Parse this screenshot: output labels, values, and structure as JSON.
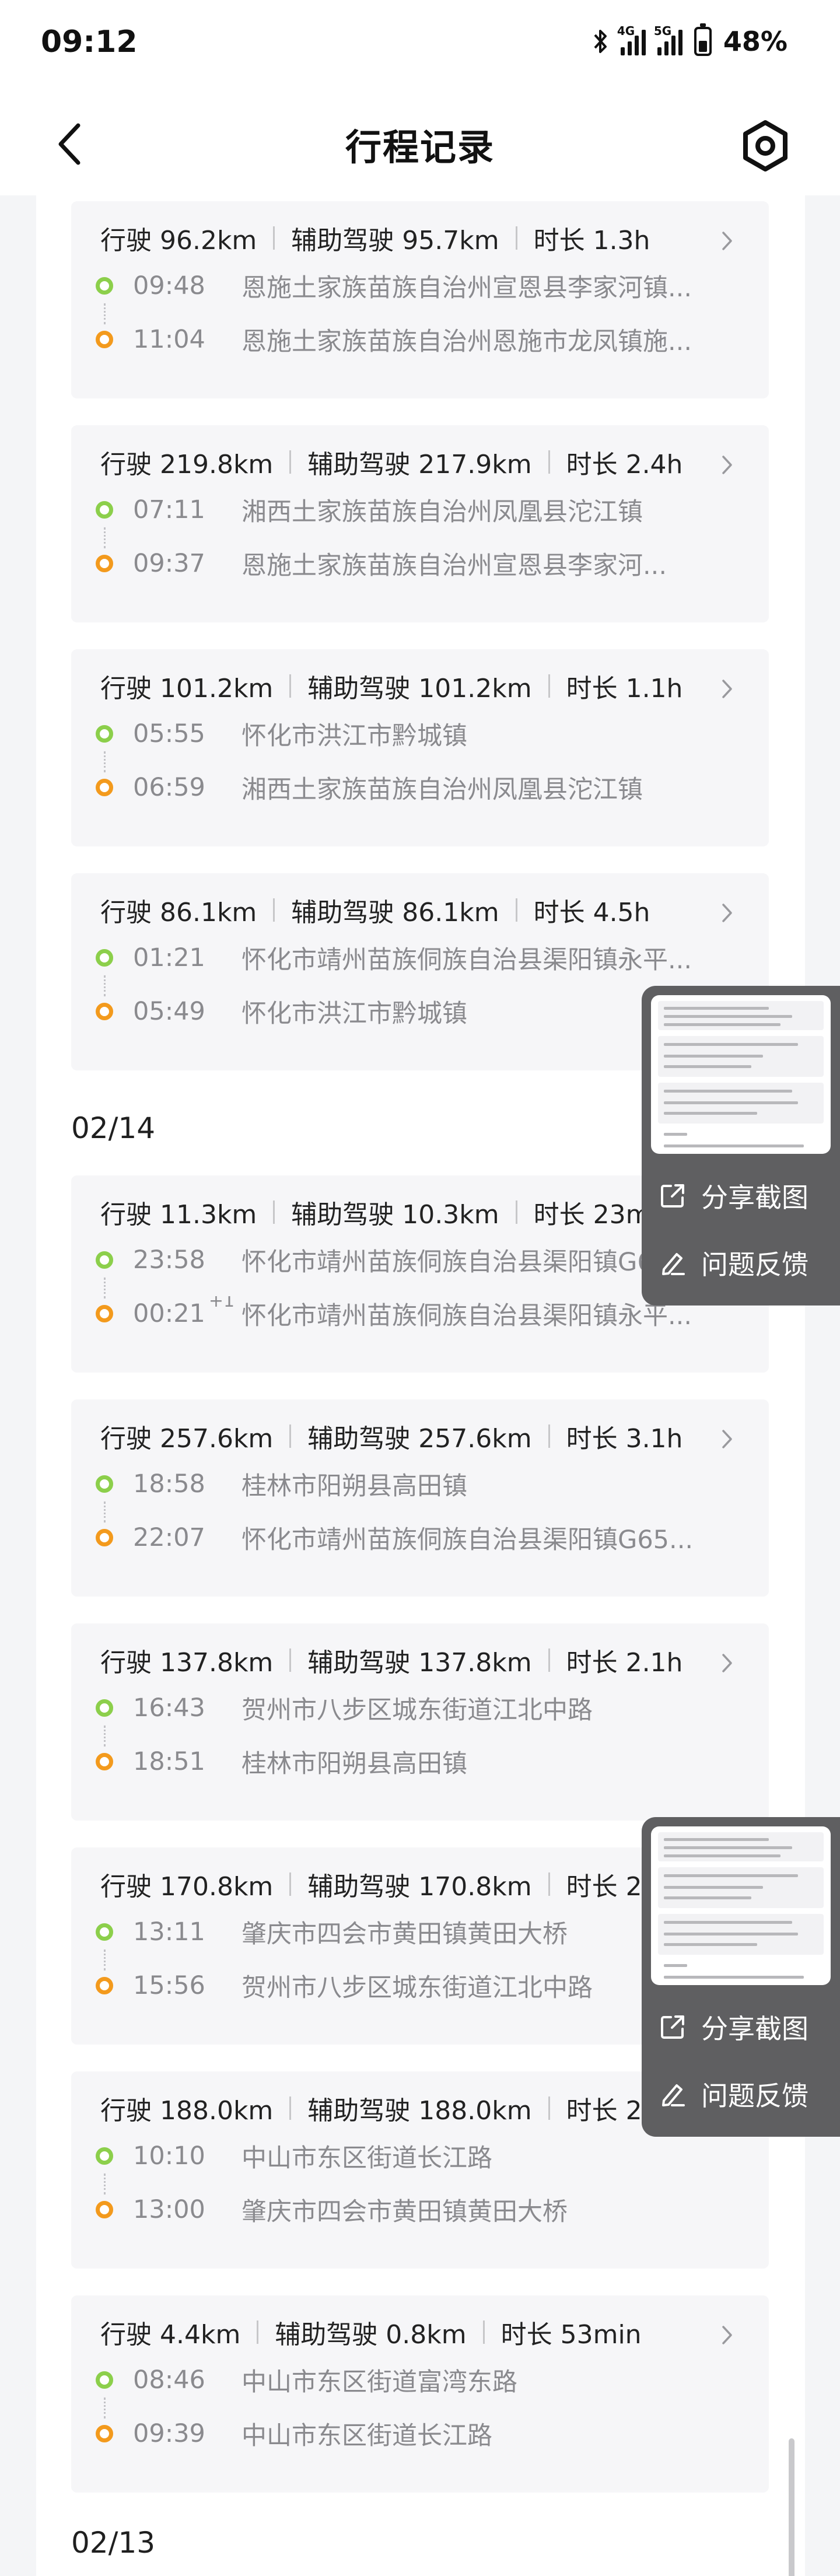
{
  "status_bar": {
    "time": "09:12",
    "network_1": "4G",
    "network_2": "5G",
    "battery": "48%"
  },
  "header": {
    "title": "行程记录"
  },
  "trips": [
    {
      "distance": "行驶 96.2km",
      "assisted": "辅助驾驶 95.7km",
      "duration": "时长 1.3h",
      "start_time": "09:48",
      "start_place": "恩施土家族苗族自治州宣恩县李家河镇...",
      "end_time": "11:04",
      "end_time_sup": "",
      "end_place": "恩施土家族苗族自治州恩施市龙凤镇施..."
    },
    {
      "distance": "行驶 219.8km",
      "assisted": "辅助驾驶 217.9km",
      "duration": "时长 2.4h",
      "start_time": "07:11",
      "start_place": "湘西土家族苗族自治州凤凰县沱江镇",
      "end_time": "09:37",
      "end_time_sup": "",
      "end_place": "恩施土家族苗族自治州宣恩县李家河..."
    },
    {
      "distance": "行驶 101.2km",
      "assisted": "辅助驾驶 101.2km",
      "duration": "时长 1.1h",
      "start_time": "05:55",
      "start_place": "怀化市洪江市黔城镇",
      "end_time": "06:59",
      "end_time_sup": "",
      "end_place": "湘西土家族苗族自治州凤凰县沱江镇"
    },
    {
      "distance": "行驶 86.1km",
      "assisted": "辅助驾驶 86.1km",
      "duration": "时长 4.5h",
      "start_time": "01:21",
      "start_place": "怀化市靖州苗族侗族自治县渠阳镇永平...",
      "end_time": "05:49",
      "end_time_sup": "",
      "end_place": "怀化市洪江市黔城镇"
    },
    {
      "distance": "行驶 11.3km",
      "assisted": "辅助驾驶 10.3km",
      "duration": "时长 23min",
      "start_time": "23:58",
      "start_place": "怀化市靖州苗族侗族自治县渠阳镇G65...",
      "end_time": "00:21",
      "end_time_sup": "+1",
      "end_place": "怀化市靖州苗族侗族自治县渠阳镇永平..."
    },
    {
      "distance": "行驶 257.6km",
      "assisted": "辅助驾驶 257.6km",
      "duration": "时长 3.1h",
      "start_time": "18:58",
      "start_place": "桂林市阳朔县高田镇",
      "end_time": "22:07",
      "end_time_sup": "",
      "end_place": "怀化市靖州苗族侗族自治县渠阳镇G65..."
    },
    {
      "distance": "行驶 137.8km",
      "assisted": "辅助驾驶 137.8km",
      "duration": "时长 2.1h",
      "start_time": "16:43",
      "start_place": "贺州市八步区城东街道江北中路",
      "end_time": "18:51",
      "end_time_sup": "",
      "end_place": "桂林市阳朔县高田镇"
    },
    {
      "distance": "行驶 170.8km",
      "assisted": "辅助驾驶 170.8km",
      "duration": "时长 2.8h",
      "start_time": "13:11",
      "start_place": "肇庆市四会市黄田镇黄田大桥",
      "end_time": "15:56",
      "end_time_sup": "",
      "end_place": "贺州市八步区城东街道江北中路"
    },
    {
      "distance": "行驶 188.0km",
      "assisted": "辅助驾驶 188.0km",
      "duration": "时长 2.8h",
      "start_time": "10:10",
      "start_place": "中山市东区街道长江路",
      "end_time": "13:00",
      "end_time_sup": "",
      "end_place": "肇庆市四会市黄田镇黄田大桥"
    },
    {
      "distance": "行驶 4.4km",
      "assisted": "辅助驾驶 0.8km",
      "duration": "时长 53min",
      "start_time": "08:46",
      "start_place": "中山市东区街道富湾东路",
      "end_time": "09:39",
      "end_time_sup": "",
      "end_place": "中山市东区街道长江路"
    }
  ],
  "date_headers": [
    "02/14",
    "02/13"
  ],
  "floating_panel": {
    "share_label": "分享截图",
    "feedback_label": "问题反馈"
  },
  "colors": {
    "start_dot": "#8ccf4b",
    "end_dot": "#f39a1d",
    "panel_bg": "#5f5f61",
    "card_bg": "#f6f6f8"
  }
}
